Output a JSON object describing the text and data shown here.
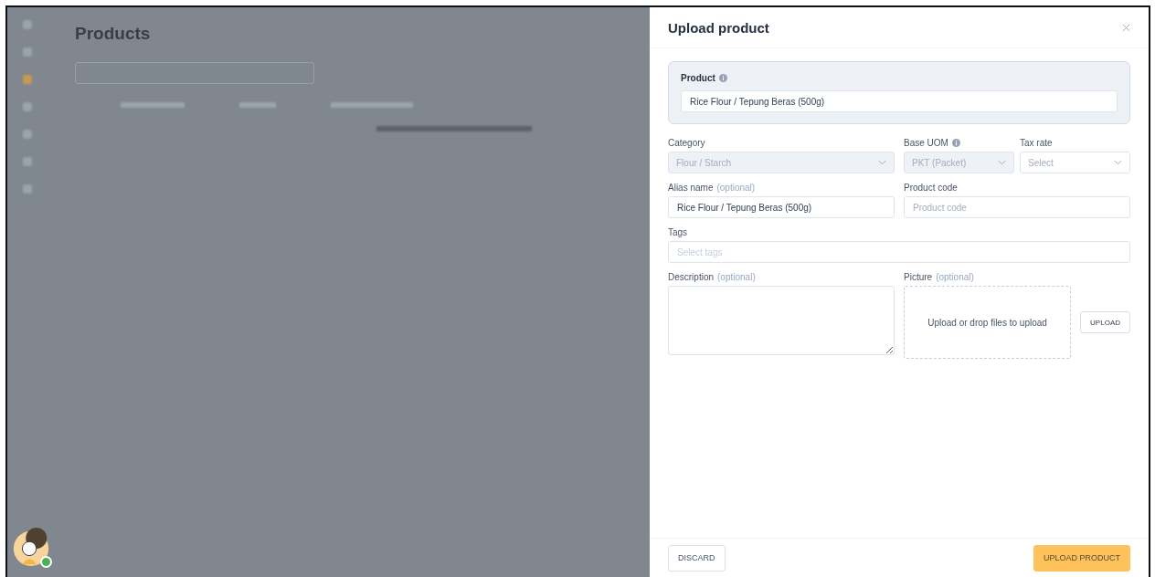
{
  "page": {
    "title": "Products"
  },
  "user": {
    "online": true
  },
  "dialog": {
    "title": "Upload product",
    "product": {
      "label": "Product",
      "value": "Rice Flour / Tepung Beras (500g)"
    },
    "fields": [
      {
        "kind": "select",
        "label": "Category",
        "value": "Flour / Starch",
        "disabled": true
      },
      {
        "kind": "select",
        "label": "Base UOM",
        "value": "PKT (Packet)",
        "disabled": true,
        "info": true
      },
      {
        "kind": "select",
        "label": "Tax rate",
        "placeholder": "Select",
        "disabled": false
      },
      {
        "kind": "text",
        "label": "Alias name",
        "optional": "(optional)",
        "value": "Rice Flour / Tepung Beras (500g)"
      },
      {
        "kind": "text",
        "label": "Product code",
        "placeholder": "Product code"
      },
      {
        "kind": "tags",
        "label": "Tags",
        "placeholder": "Select tags"
      }
    ],
    "description": {
      "label": "Description",
      "optional": "(optional)"
    },
    "picture": {
      "label": "Picture",
      "optional": "(optional)",
      "drop_text": "Upload or drop files to upload",
      "button": "UPLOAD"
    },
    "discard": "DISCARD",
    "submit": "UPLOAD PRODUCT"
  }
}
